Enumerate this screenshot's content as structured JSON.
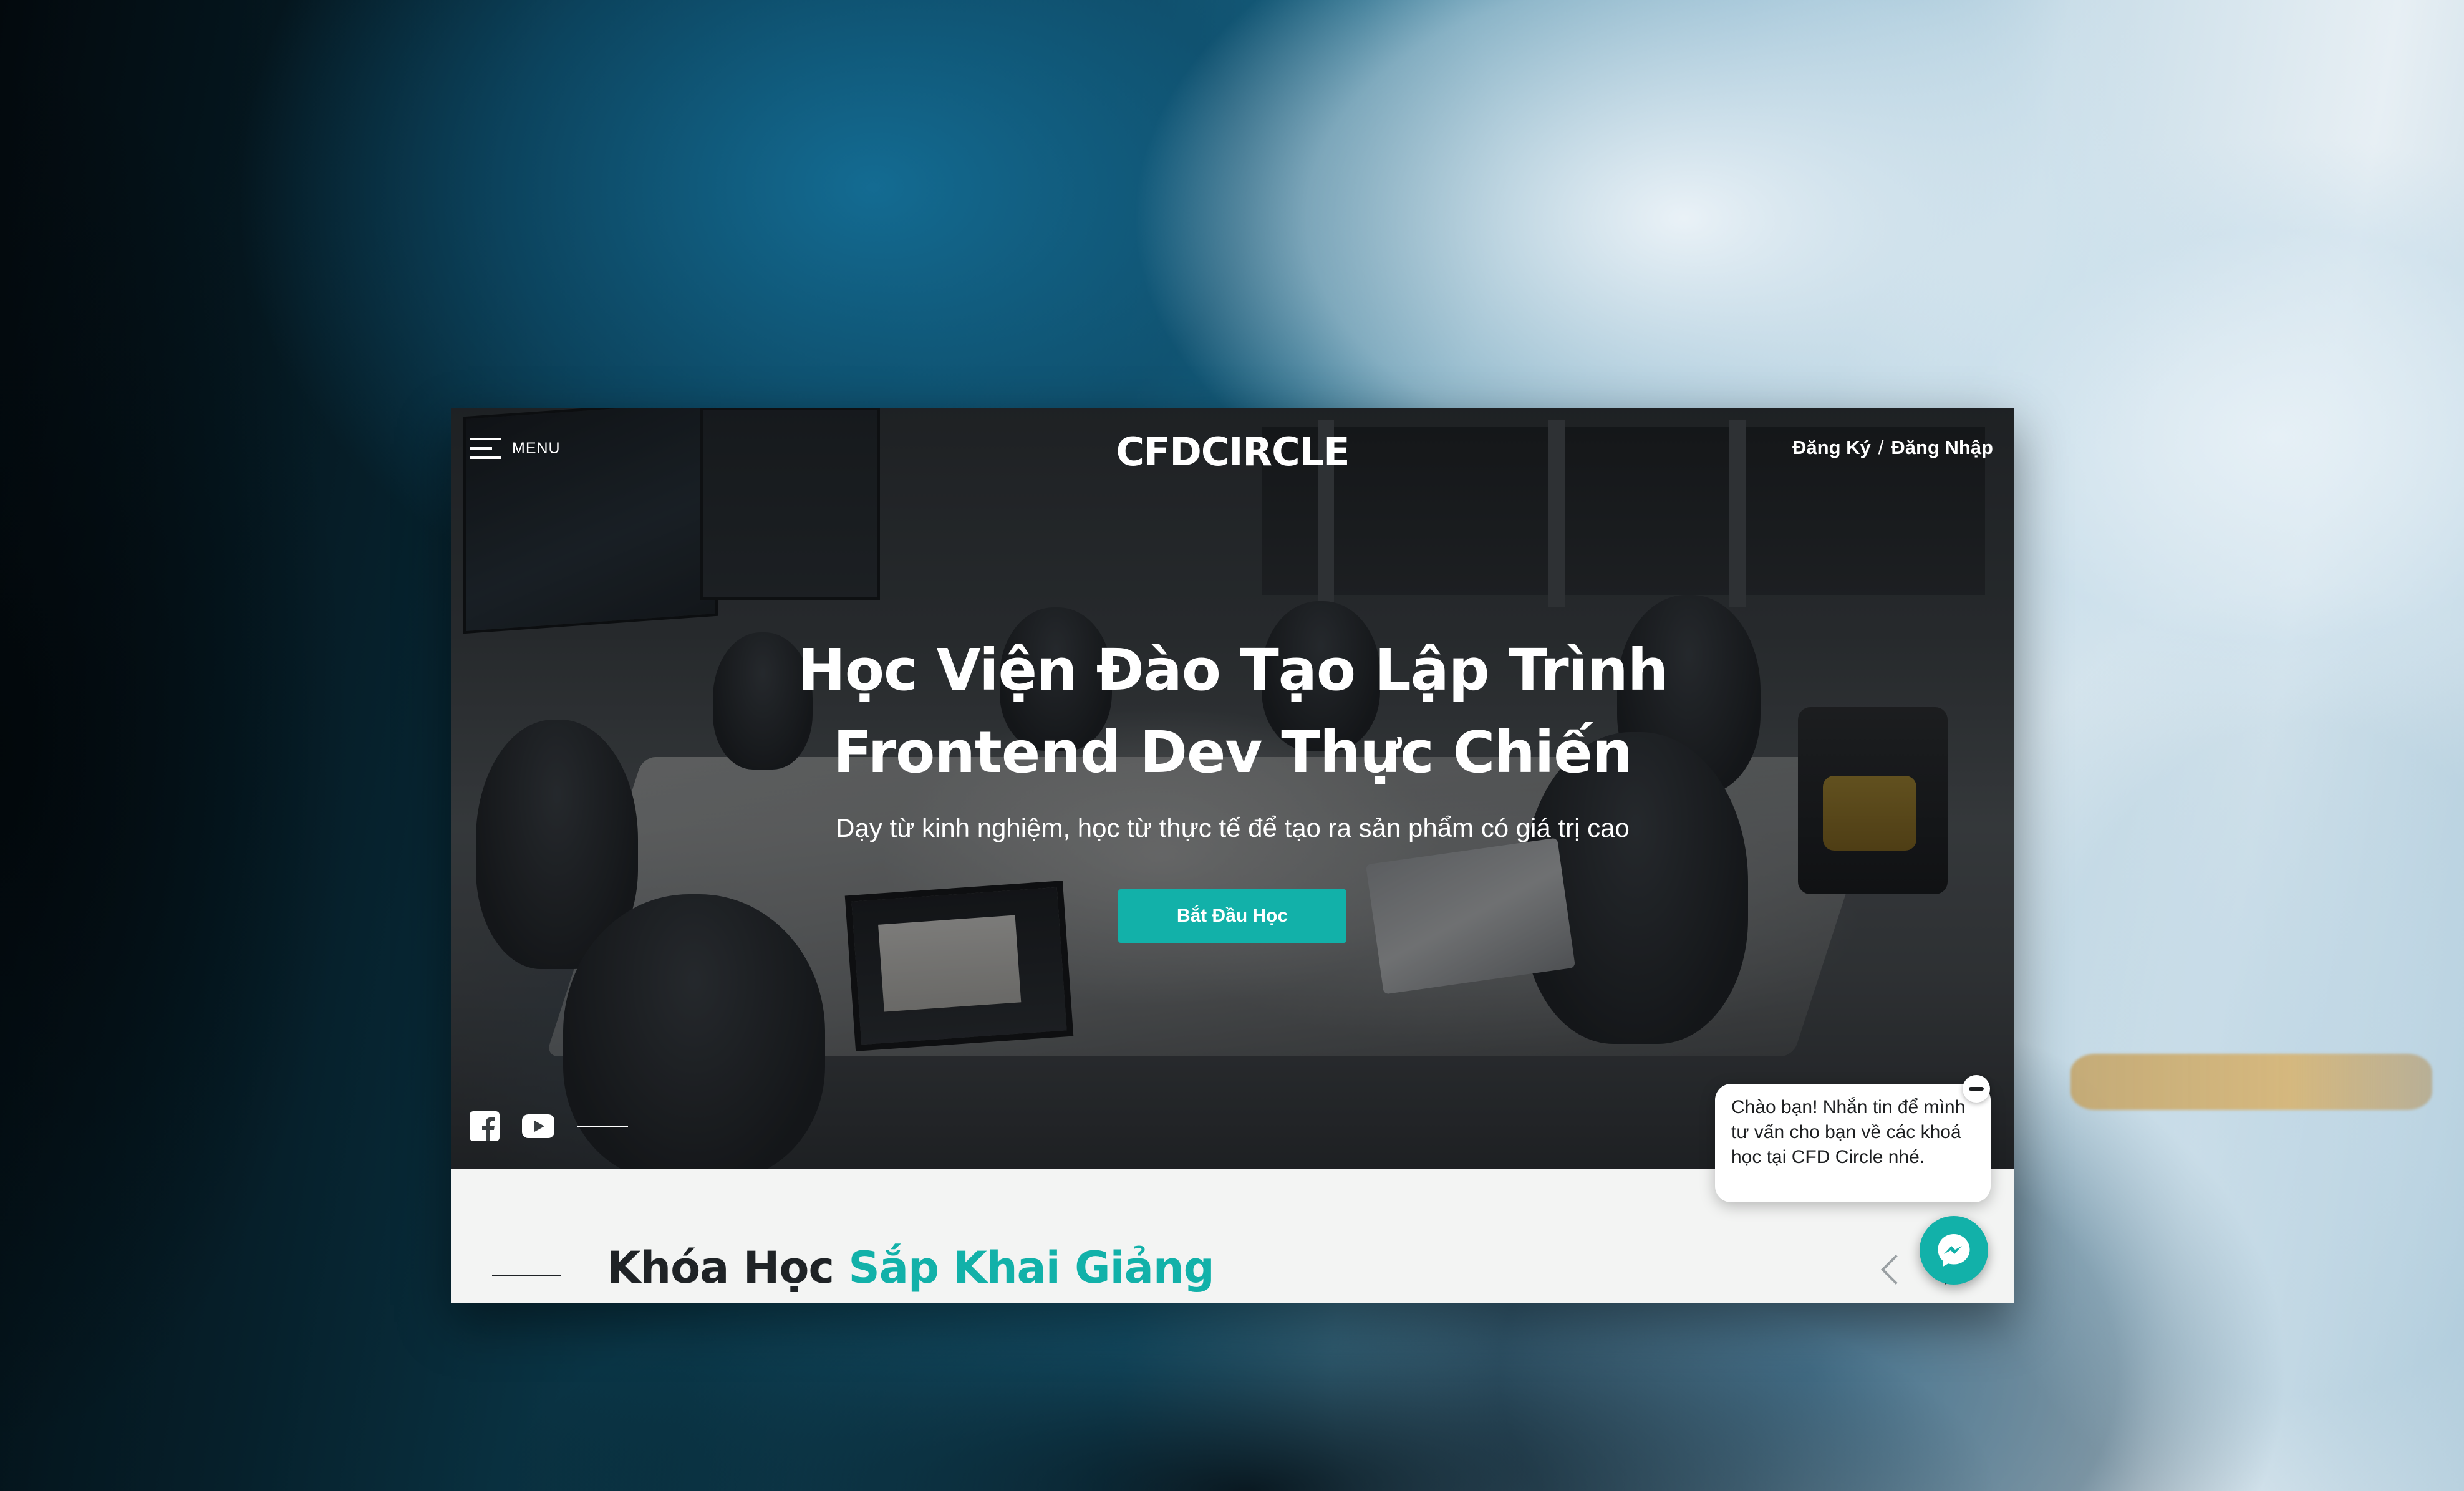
{
  "header": {
    "menu_label": "MENU",
    "logo": "CFDCIRCLE",
    "register": "Đăng Ký",
    "separator": "/",
    "login": "Đăng Nhập"
  },
  "hero": {
    "title_line1": "Học Viện Đào Tạo Lập Trình",
    "title_line2": "Frontend Dev Thực Chiến",
    "subtitle": "Dạy từ kinh nghiệm, học từ thực tế để tạo ra sản phẩm có giá trị cao",
    "cta_label": "Bắt Đầu Học"
  },
  "social": {
    "icons": [
      "facebook-icon",
      "youtube-icon"
    ]
  },
  "section": {
    "title_part1": "Khóa Học",
    "title_part2": "Sắp Khai Giảng"
  },
  "chat": {
    "message": "Chào bạn! Nhắn tin để mình tư vấn cho bạn về các khoá học tại CFD Circle nhé."
  },
  "colors": {
    "accent": "#12b1a9",
    "dark_text": "#1f2326",
    "section_bg": "#f3f4f3"
  }
}
